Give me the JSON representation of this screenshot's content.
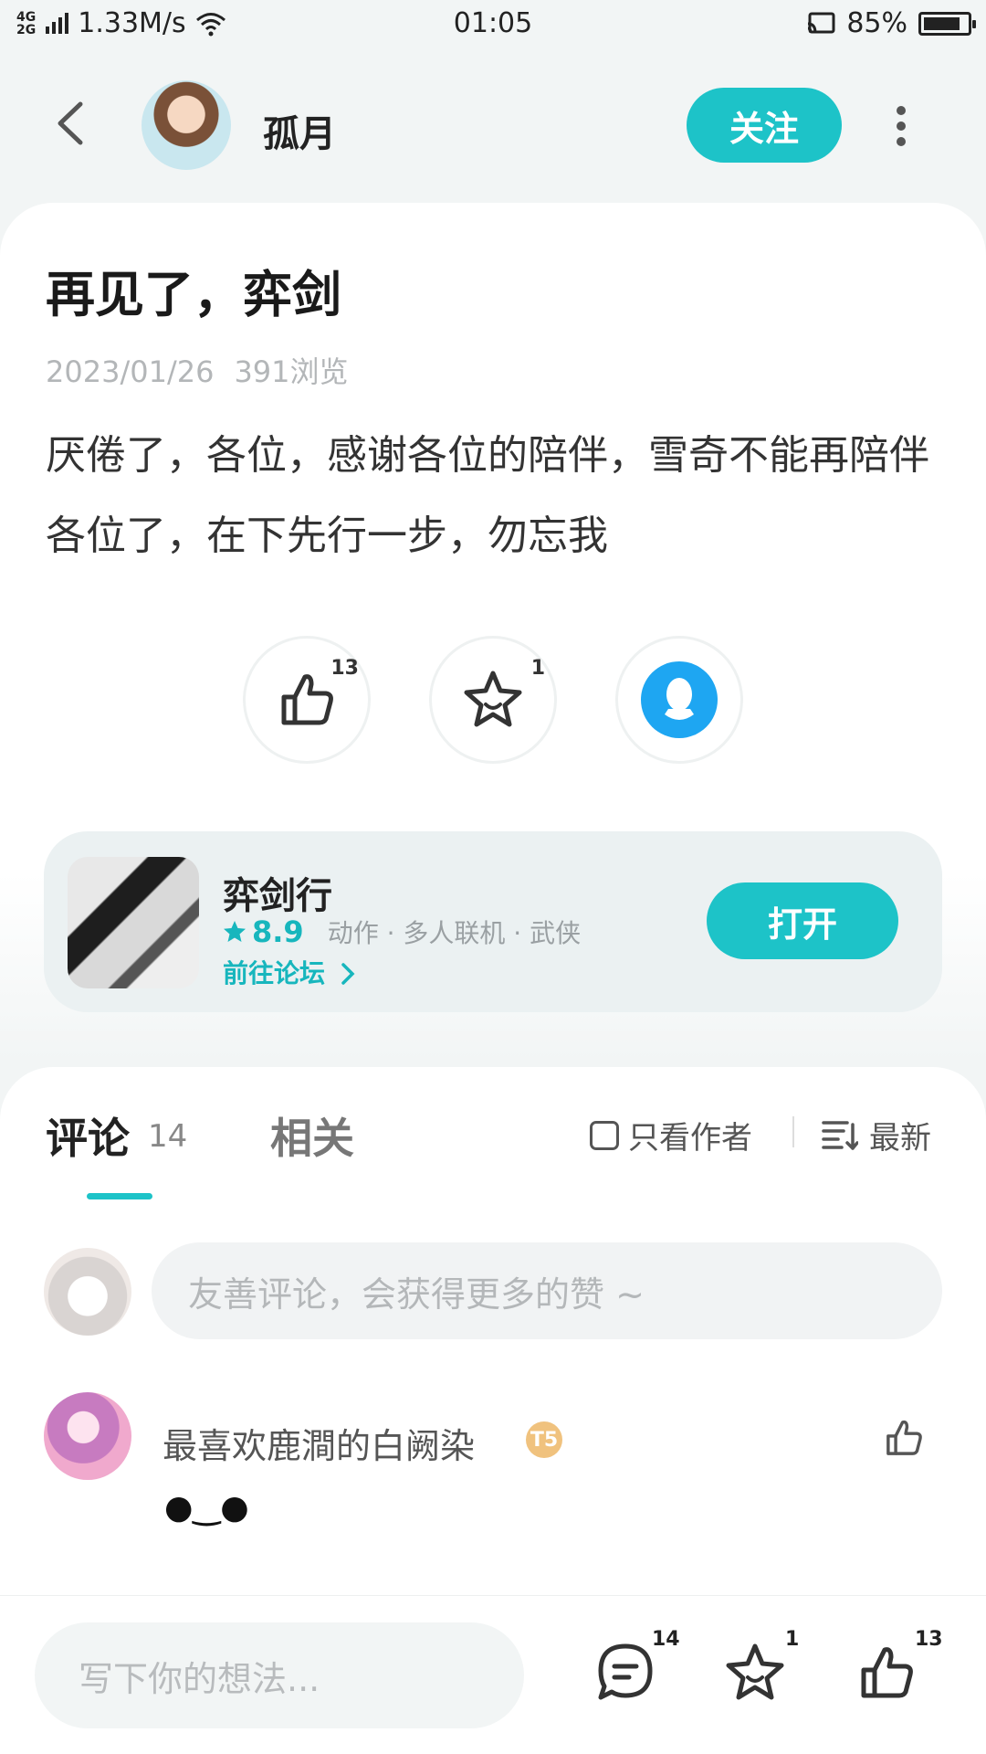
{
  "status_bar": {
    "network": "4G​2G",
    "speed": "1.33M/s",
    "time": "01:05",
    "battery_pct_text": "85%",
    "battery_level": 0.85
  },
  "header": {
    "author_name": "孤月",
    "follow_label": "关注"
  },
  "post": {
    "title": "再见了，弈剑",
    "date": "2023/01/26",
    "views": "391浏览",
    "body": "厌倦了，各位，感谢各位的陪伴，雪奇不能再陪伴各位了，在下先行一步，勿忘我",
    "like_count": "13",
    "star_count": "1"
  },
  "game": {
    "name": "弈剑行",
    "score": "8.9",
    "tags": "动作 · 多人联机 · 武侠",
    "forum_link": "前往论坛",
    "open_label": "打开"
  },
  "comments_section": {
    "tab_comments": "评论",
    "comments_count": "14",
    "tab_related": "相关",
    "only_author": "只看作者",
    "sort_label": "最新",
    "input_placeholder": "友善评论，会获得更多的赞 ~",
    "items": [
      {
        "user": "最喜欢鹿澗的白阙染",
        "badge": "T5",
        "text": "●‿●"
      }
    ]
  },
  "bottom_bar": {
    "write_placeholder": "写下你的想法...",
    "comment_count": "14",
    "star_count": "1",
    "like_count": "13"
  },
  "colors": {
    "accent": "#1dc3c8",
    "qq_blue": "#1ea6f2"
  }
}
